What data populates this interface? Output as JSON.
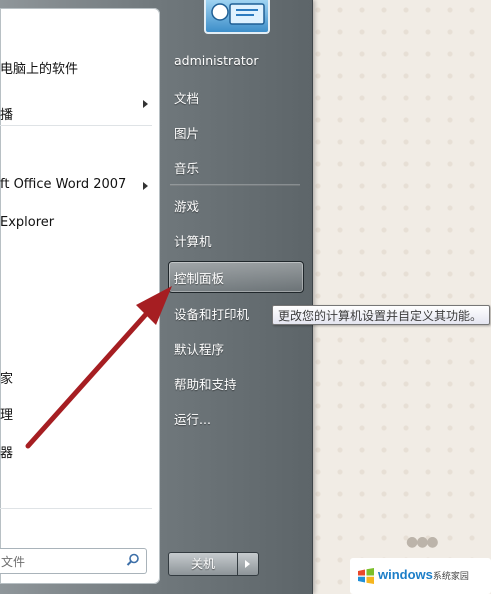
{
  "left_pane": {
    "items": [
      {
        "label": "电脑上的软件"
      },
      {
        "label": "播"
      },
      {
        "label": "ft Office Word 2007"
      },
      {
        "label": "Explorer"
      },
      {
        "label": "家"
      },
      {
        "label": "理"
      },
      {
        "label": "器"
      }
    ],
    "search_placeholder": "文件"
  },
  "right_pane": {
    "user_name": "administrator",
    "items": [
      {
        "label": "文档"
      },
      {
        "label": "图片"
      },
      {
        "label": "音乐"
      },
      {
        "label": "游戏"
      },
      {
        "label": "计算机"
      },
      {
        "label": "控制面板"
      },
      {
        "label": "设备和打印机"
      },
      {
        "label": "默认程序"
      },
      {
        "label": "帮助和支持"
      },
      {
        "label": "运行..."
      }
    ],
    "shutdown_label": "关机"
  },
  "tooltip": {
    "text": "更改您的计算机设置并自定义其功能。"
  },
  "watermark": {
    "brand": "windows",
    "sub": "系统家园",
    "logo_icon": "windows-logo-icon"
  },
  "colors": {
    "annotation_arrow": "#a61e22",
    "start_menu_dark": "#5d6569",
    "watermark_blue": "#1c7ec8"
  }
}
